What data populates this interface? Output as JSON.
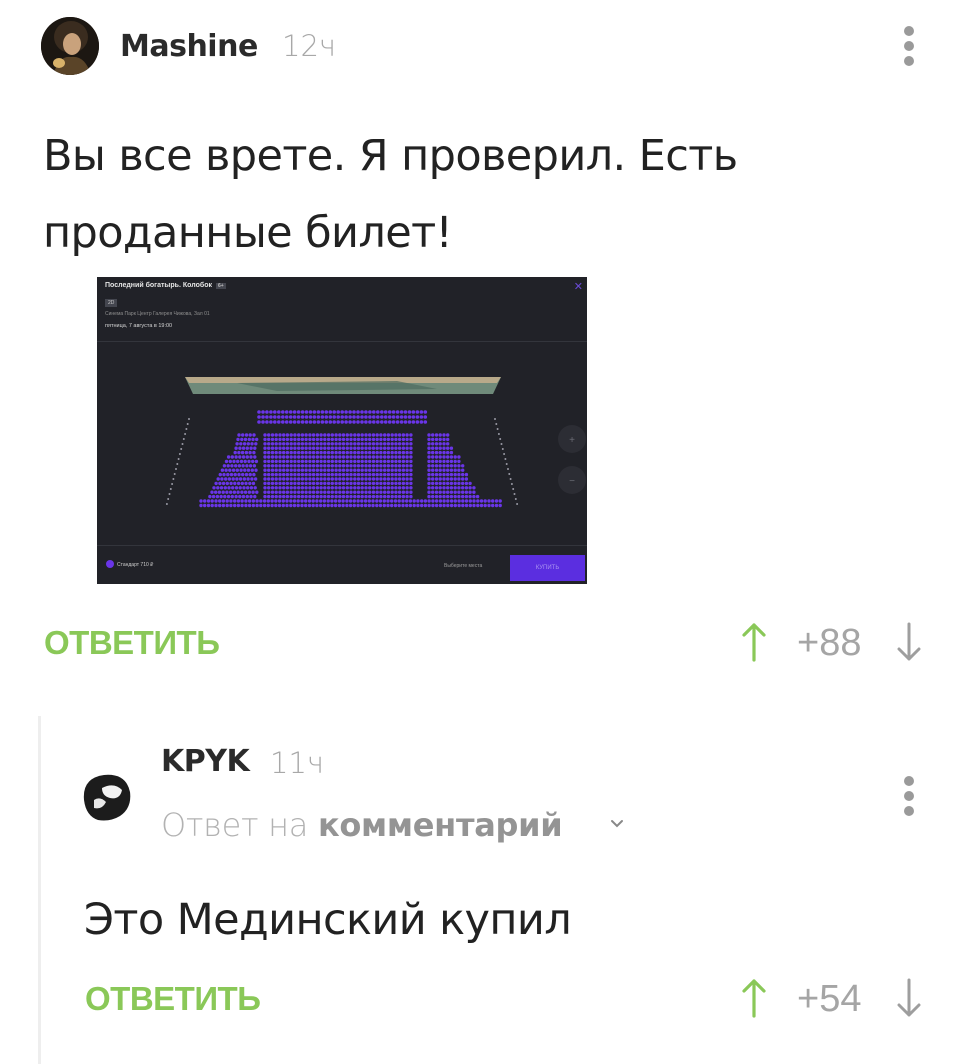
{
  "comment": {
    "username": "Mashine",
    "time": "12ч",
    "text_line1": "Вы все врете. Я проверил. Есть",
    "text_line2": "проданные билет!",
    "reply_label": "ОТВЕТИТЬ",
    "rating": "+88",
    "attachment": {
      "title": "Последний богатырь. Колобок",
      "age_badge": "6+",
      "format": "2D",
      "venue": "Синема Парк Центр Галерея Чижова, Зал 01",
      "datetime": "пятница, 7 августа в 19:00",
      "legend": "Стандарт 710 ₽",
      "select_hint": "Выберите места",
      "buy_label": "КУПИТЬ",
      "zoom_in": "+",
      "zoom_out": "−",
      "seat_color": "#6a35e8"
    }
  },
  "reply": {
    "username": "KPYK",
    "time": "11ч",
    "reply_prefix": "Ответ на",
    "reply_target": "комментарий",
    "text": "Это Мединский купил",
    "reply_label": "ОТВЕТИТЬ",
    "rating": "+54"
  },
  "colors": {
    "accent_green": "#8ac858",
    "muted_gray": "#a5a5a5"
  },
  "icons": [
    "more-vertical-icon",
    "arrow-up-icon",
    "arrow-down-icon",
    "chevron-down-icon"
  ]
}
